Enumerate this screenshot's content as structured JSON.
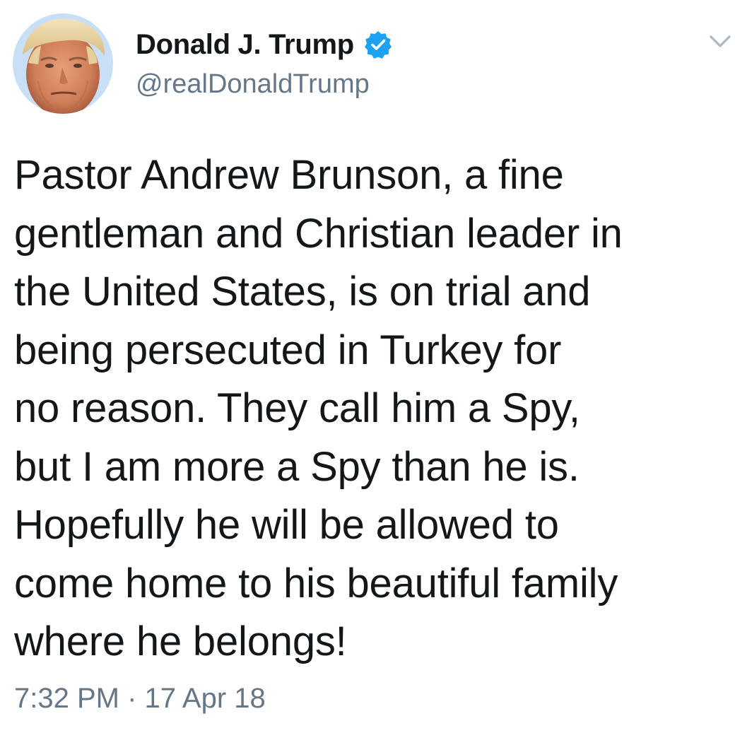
{
  "author": {
    "display_name": "Donald J. Trump",
    "handle": "@realDonaldTrump",
    "verified": true,
    "avatar_icon": "profile-photo",
    "verified_icon": "verified-badge-icon",
    "menu_icon": "chevron-down-icon"
  },
  "tweet": {
    "lines": [
      "Pastor Andrew Brunson, a fine",
      "gentleman and Christian leader in",
      "the United States, is on trial and",
      "being persecuted in Turkey for",
      "no reason. They call him a Spy,",
      "but I am more a Spy than he is.",
      "Hopefully he will be allowed to",
      "come home to his beautiful family",
      "where he belongs!"
    ]
  },
  "meta": {
    "timestamp": "7:32 PM · 17 Apr 18"
  },
  "colors": {
    "text": "#14171a",
    "secondary": "#657786",
    "verified": "#1da1f2",
    "avatar_bg": "#c9dff5"
  }
}
